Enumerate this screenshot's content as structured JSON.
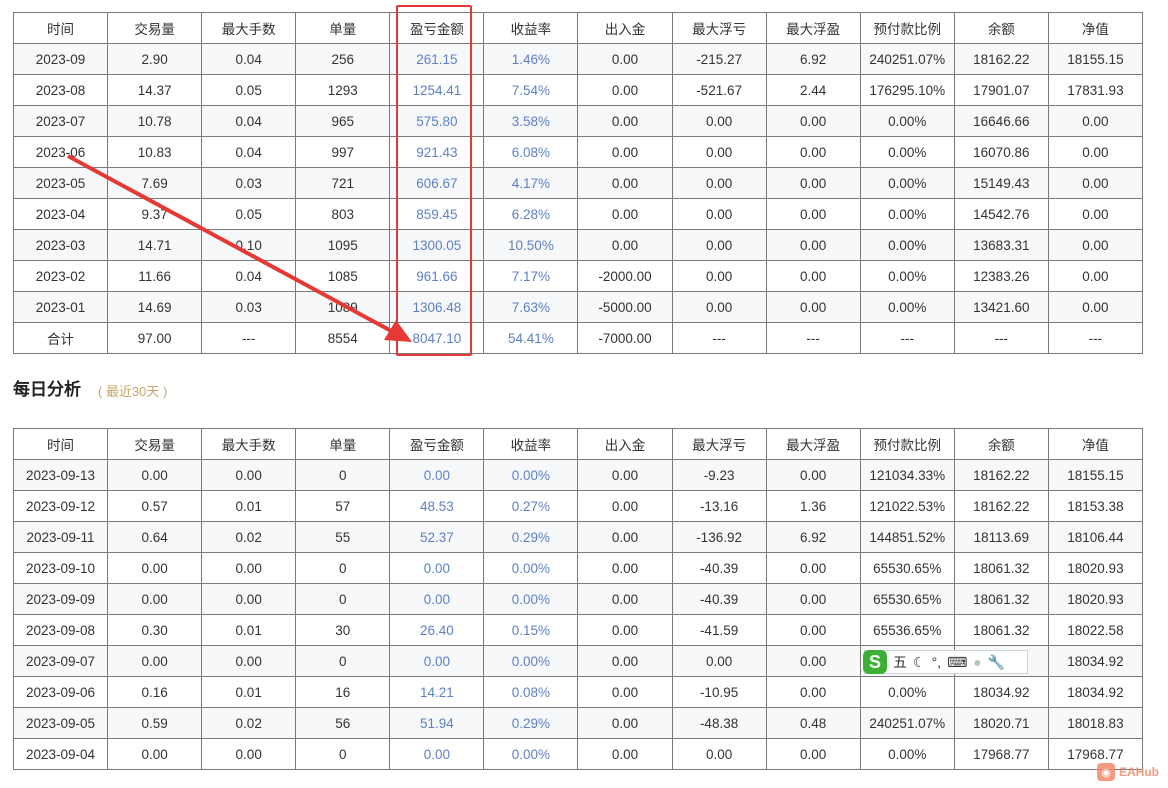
{
  "columns": [
    "时间",
    "交易量",
    "最大手数",
    "单量",
    "盈亏金额",
    "收益率",
    "出入金",
    "最大浮亏",
    "最大浮盈",
    "预付款比例",
    "余额",
    "净值"
  ],
  "monthly": {
    "rows": [
      [
        "2023-09",
        "2.90",
        "0.04",
        "256",
        "261.15",
        "1.46%",
        "0.00",
        "-215.27",
        "6.92",
        "240251.07%",
        "18162.22",
        "18155.15"
      ],
      [
        "2023-08",
        "14.37",
        "0.05",
        "1293",
        "1254.41",
        "7.54%",
        "0.00",
        "-521.67",
        "2.44",
        "176295.10%",
        "17901.07",
        "17831.93"
      ],
      [
        "2023-07",
        "10.78",
        "0.04",
        "965",
        "575.80",
        "3.58%",
        "0.00",
        "0.00",
        "0.00",
        "0.00%",
        "16646.66",
        "0.00"
      ],
      [
        "2023-06",
        "10.83",
        "0.04",
        "997",
        "921.43",
        "6.08%",
        "0.00",
        "0.00",
        "0.00",
        "0.00%",
        "16070.86",
        "0.00"
      ],
      [
        "2023-05",
        "7.69",
        "0.03",
        "721",
        "606.67",
        "4.17%",
        "0.00",
        "0.00",
        "0.00",
        "0.00%",
        "15149.43",
        "0.00"
      ],
      [
        "2023-04",
        "9.37",
        "0.05",
        "803",
        "859.45",
        "6.28%",
        "0.00",
        "0.00",
        "0.00",
        "0.00%",
        "14542.76",
        "0.00"
      ],
      [
        "2023-03",
        "14.71",
        "0.10",
        "1095",
        "1300.05",
        "10.50%",
        "0.00",
        "0.00",
        "0.00",
        "0.00%",
        "13683.31",
        "0.00"
      ],
      [
        "2023-02",
        "11.66",
        "0.04",
        "1085",
        "961.66",
        "7.17%",
        "-2000.00",
        "0.00",
        "0.00",
        "0.00%",
        "12383.26",
        "0.00"
      ],
      [
        "2023-01",
        "14.69",
        "0.03",
        "1089",
        "1306.48",
        "7.63%",
        "-5000.00",
        "0.00",
        "0.00",
        "0.00%",
        "13421.60",
        "0.00"
      ],
      [
        "合计",
        "97.00",
        "---",
        "8554",
        "8047.10",
        "54.41%",
        "-7000.00",
        "---",
        "---",
        "---",
        "---",
        "---"
      ]
    ]
  },
  "daily": {
    "title": "每日分析",
    "subtitle": "( 最近30天 )",
    "rows": [
      [
        "2023-09-13",
        "0.00",
        "0.00",
        "0",
        "0.00",
        "0.00%",
        "0.00",
        "-9.23",
        "0.00",
        "121034.33%",
        "18162.22",
        "18155.15"
      ],
      [
        "2023-09-12",
        "0.57",
        "0.01",
        "57",
        "48.53",
        "0.27%",
        "0.00",
        "-13.16",
        "1.36",
        "121022.53%",
        "18162.22",
        "18153.38"
      ],
      [
        "2023-09-11",
        "0.64",
        "0.02",
        "55",
        "52.37",
        "0.29%",
        "0.00",
        "-136.92",
        "6.92",
        "144851.52%",
        "18113.69",
        "18106.44"
      ],
      [
        "2023-09-10",
        "0.00",
        "0.00",
        "0",
        "0.00",
        "0.00%",
        "0.00",
        "-40.39",
        "0.00",
        "65530.65%",
        "18061.32",
        "18020.93"
      ],
      [
        "2023-09-09",
        "0.00",
        "0.00",
        "0",
        "0.00",
        "0.00%",
        "0.00",
        "-40.39",
        "0.00",
        "65530.65%",
        "18061.32",
        "18020.93"
      ],
      [
        "2023-09-08",
        "0.30",
        "0.01",
        "30",
        "26.40",
        "0.15%",
        "0.00",
        "-41.59",
        "0.00",
        "65536.65%",
        "18061.32",
        "18022.58"
      ],
      [
        "2023-09-07",
        "0.00",
        "0.00",
        "0",
        "0.00",
        "0.00%",
        "0.00",
        "0.00",
        "0.00",
        "",
        "",
        "18034.92"
      ],
      [
        "2023-09-06",
        "0.16",
        "0.01",
        "16",
        "14.21",
        "0.08%",
        "0.00",
        "-10.95",
        "0.00",
        "0.00%",
        "18034.92",
        "18034.92"
      ],
      [
        "2023-09-05",
        "0.59",
        "0.02",
        "56",
        "51.94",
        "0.29%",
        "0.00",
        "-48.38",
        "0.48",
        "240251.07%",
        "18020.71",
        "18018.83"
      ],
      [
        "2023-09-04",
        "0.00",
        "0.00",
        "0",
        "0.00",
        "0.00%",
        "0.00",
        "0.00",
        "0.00",
        "0.00%",
        "17968.77",
        "17968.77"
      ]
    ]
  },
  "ime_toolbar": {
    "logo": "S",
    "mode": "五"
  },
  "watermark": {
    "logo": "EA",
    "text": "EAHub"
  },
  "colors": {
    "accent_blue": "#5d7fc9",
    "highlight_red": "#e53935",
    "subtitle_gold": "#c8a56a"
  }
}
